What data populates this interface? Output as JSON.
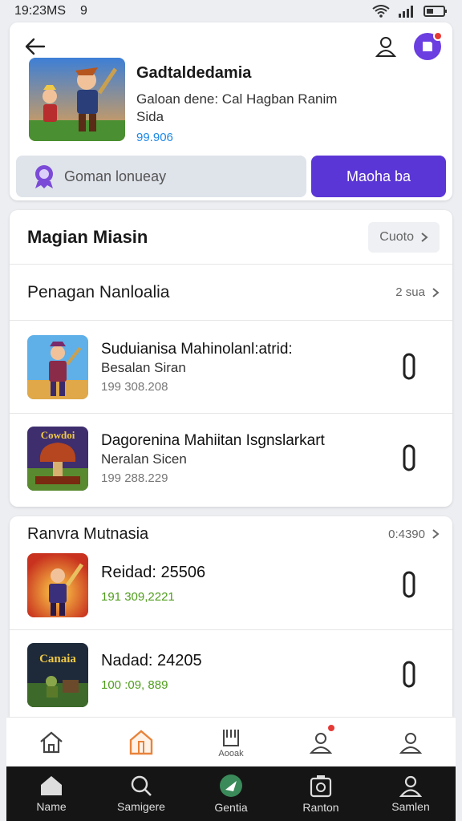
{
  "status_bar": {
    "time": "19:23MS",
    "extra": "9"
  },
  "header": {
    "title": "Gadtaldedamia",
    "subtitle": "Galoan dene: Cal Hagban Ranim Sida",
    "price": "99.906",
    "secondary_button": "Goman lonueay",
    "primary_button": "Maoha ba"
  },
  "section1": {
    "title": "Magian Miasin",
    "pill_label": "Cuoto",
    "sub_header": "Penagan Nanloalia",
    "sub_more": "2 sua"
  },
  "list1": [
    {
      "title": "Suduianisa Mahinolanl:atrid:",
      "subtitle": "Besalan Siran",
      "meta": "199 308.208"
    },
    {
      "title": "Dagorenina Mahiitan Isgnslarkart",
      "subtitle": "Neralan Sicen",
      "meta": "199 288.229"
    }
  ],
  "section2": {
    "title": "Ranvra Mutnasia",
    "more": "0:4390"
  },
  "list2": [
    {
      "title": "Reidad: 25506",
      "meta": "191 309,2221"
    },
    {
      "title": "Nadad: 24205",
      "meta": "100 :09, 889"
    }
  ],
  "thumb_labels": {
    "game3": "Cowdoi",
    "game5": "Canaia"
  },
  "nav_upper": [
    {
      "icon": "home-icon",
      "label": ""
    },
    {
      "icon": "store-icon",
      "label": ""
    },
    {
      "icon": "bookmark-icon",
      "label": "Aooak"
    },
    {
      "icon": "profile-badge-icon",
      "label": ""
    },
    {
      "icon": "user-icon",
      "label": ""
    }
  ],
  "nav_lower": [
    {
      "icon": "home-icon",
      "label": "Name"
    },
    {
      "icon": "search-icon",
      "label": "Samigere"
    },
    {
      "icon": "play-icon",
      "label": "Gentia"
    },
    {
      "icon": "camera-icon",
      "label": "Ranton"
    },
    {
      "icon": "user-icon",
      "label": "Samlen"
    }
  ],
  "colors": {
    "accent": "#5b36d6",
    "price": "#1e88e5",
    "green": "#4f9d1c"
  }
}
